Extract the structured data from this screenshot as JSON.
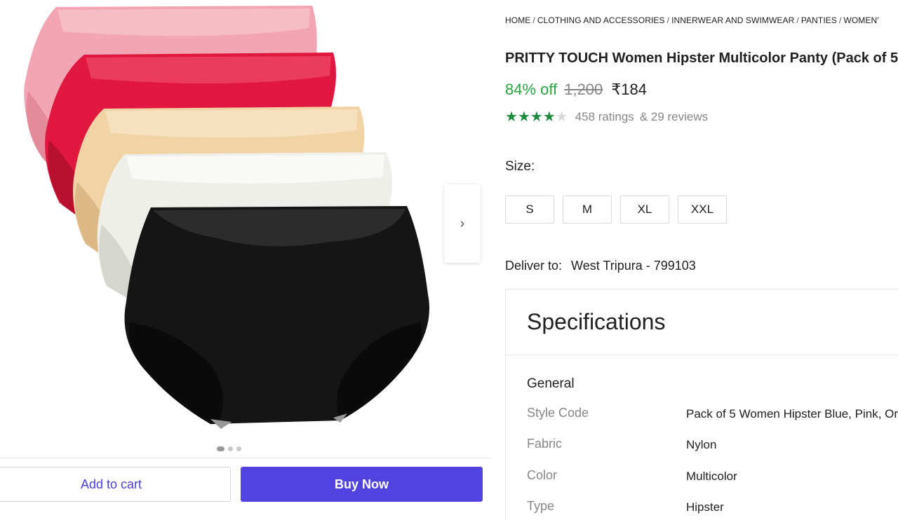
{
  "gallery": {
    "product_image_alt": "Five hipster panties stacked: pink, red, beige, white, black",
    "next_arrow": "›",
    "dots": [
      true,
      false,
      false
    ]
  },
  "actions": {
    "add_to_cart": "Add to cart",
    "buy_now": "Buy Now",
    "accent_color": "#5243e0"
  },
  "breadcrumb": [
    "HOME",
    "CLOTHING AND ACCESSORIES",
    "INNERWEAR AND SWIMWEAR",
    "PANTIES",
    "WOMEN'"
  ],
  "product": {
    "title": "PRITTY TOUCH Women Hipster Multicolor Panty (Pack of 5",
    "discount": "84% off",
    "mrp": "1,200",
    "price": "₹184",
    "rating_stars": 4,
    "ratings_text": "458 ratings",
    "reviews_text": "& 29 reviews"
  },
  "size": {
    "label": "Size:",
    "options": [
      "S",
      "M",
      "XL",
      "XXL"
    ]
  },
  "delivery": {
    "label": "Deliver to:",
    "location": "West Tripura - 799103"
  },
  "specifications": {
    "title": "Specifications",
    "section": "General",
    "rows": [
      {
        "key": "Style Code",
        "value": "Pack of 5 Women Hipster Blue, Pink, Or"
      },
      {
        "key": "Fabric",
        "value": "Nylon"
      },
      {
        "key": "Color",
        "value": "Multicolor"
      },
      {
        "key": "Type",
        "value": "Hipster"
      }
    ]
  }
}
